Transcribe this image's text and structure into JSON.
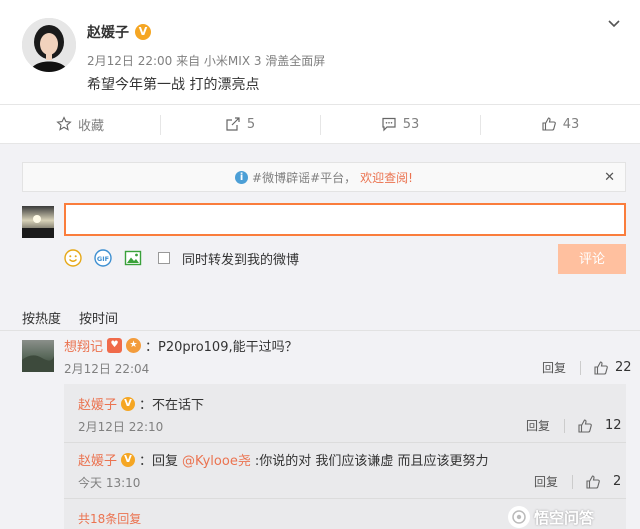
{
  "post": {
    "author": "赵媛子",
    "meta": "2月12日 22:00 来自 小米MIX 3 滑盖全面屏",
    "text": "希望今年第一战 打的漂亮点"
  },
  "actions": {
    "favorite_label": "收藏",
    "repost_count": "5",
    "comment_count": "53",
    "like_count": "43"
  },
  "notice": {
    "text": "#微博辟谣#平台，",
    "welcome": "欢迎查阅!",
    "close": "✕"
  },
  "composer": {
    "input_value": "",
    "gif_label": "GIF",
    "repost_checkbox_label": "同时转发到我的微博",
    "submit_label": "评论"
  },
  "sort": {
    "by_hot": "按热度",
    "by_time": "按时间"
  },
  "comment": {
    "user": "想翔记",
    "text": "：P20pro109,能干过吗？",
    "time": "2月12日 22:04",
    "reply_label": "回复",
    "likes": "22"
  },
  "replies": [
    {
      "user": "赵媛子",
      "text": "：不在话下",
      "time": "2月12日 22:10",
      "reply_label": "回复",
      "likes": "12"
    },
    {
      "user": "赵媛子",
      "prefix": "：回复",
      "mention": "@Kylooe尧",
      "text": ":你说的对 我们应该谦虚 而且应该更努力",
      "time": "今天 13:10",
      "reply_label": "回复",
      "likes": "2"
    }
  ],
  "more_replies": "共18条回复",
  "watermark": "悟空问答",
  "colors": {
    "accent": "#eb7350",
    "input_border": "#fa7d3c",
    "submit_bg": "#ffc09f",
    "vip": "#f5a623",
    "info_blue": "#4c9fd6"
  }
}
